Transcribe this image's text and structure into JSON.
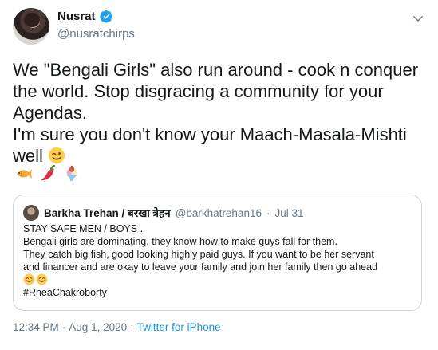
{
  "author": {
    "name": "Nusrat",
    "handle": "@nusratchirps"
  },
  "tweet": {
    "text": "We \"Bengali Girls\" also run around - cook n conquer the world. Stop disgracing a community for your Agendas.\nI'm sure you don't know your Maach-Masala-Mishti well ",
    "emojis": [
      "winking-face",
      "fish",
      "hot-pepper",
      "ice-cream"
    ]
  },
  "quoted": {
    "name": "Barkha Trehan / बरखा त्रेहन",
    "handle": "@barkhatrehan16",
    "separator": "·",
    "date": "Jul 31",
    "lines": [
      "STAY SAFE MEN / BOYS .",
      "Bengali girls are dominating, they know how to make guys fall for them.",
      "They catch big fish, good looking highly paid guys. If you want to be her servant",
      "and financer and are okay to leave your family and join her family then go ahead"
    ],
    "hashtag": "#RheaChakroborty",
    "emojis": [
      "smiling-face",
      "smiling-face"
    ]
  },
  "meta": {
    "time": "12:34 PM",
    "separator1": "·",
    "date": "Aug 1, 2020",
    "separator2": "·",
    "source": "Twitter for iPhone"
  },
  "colors": {
    "accent": "#1da1f2",
    "secondary_text": "#657786",
    "border": "#ccd6dd"
  }
}
